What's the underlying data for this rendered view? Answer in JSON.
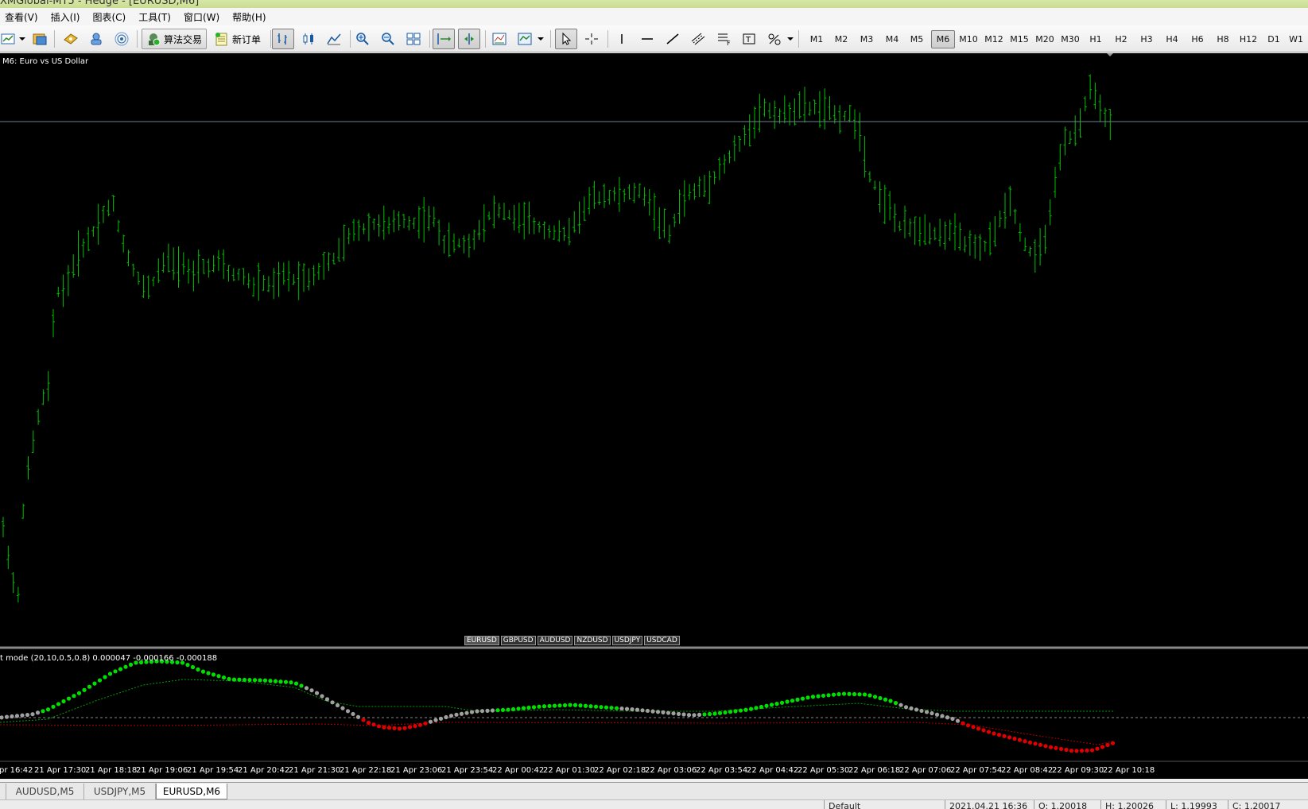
{
  "window": {
    "title": "XMGlobal-MT5 - Hedge - [EURUSD,M6]"
  },
  "menu": [
    "查看(V)",
    "插入(I)",
    "图表(C)",
    "工具(T)",
    "窗口(W)",
    "帮助(H)"
  ],
  "toolbar": {
    "algo_trading_label": "算法交易",
    "new_order_label": "新订单",
    "timeframes": [
      "M1",
      "M2",
      "M3",
      "M4",
      "M5",
      "M6",
      "M10",
      "M12",
      "M15",
      "M20",
      "M30",
      "H1",
      "H2",
      "H3",
      "H4",
      "H6",
      "H8",
      "H12",
      "D1",
      "W1"
    ],
    "active_timeframe": "M6"
  },
  "chart": {
    "label": "M6:  Euro vs US Dollar",
    "indicator_label": "t mode (20,10,0.5,0.8) 0.000047 -0.000166 -0.000188",
    "symbol_tabs": [
      "EURUSD",
      "GBPUSD",
      "AUDUSD",
      "NZDUSD",
      "USDJPY",
      "USDCAD"
    ],
    "active_symbol": "EURUSD",
    "time_labels": [
      "pr 16:42",
      "21 Apr 17:30",
      "21 Apr 18:18",
      "21 Apr 19:06",
      "21 Apr 19:54",
      "21 Apr 20:42",
      "21 Apr 21:30",
      "21 Apr 22:18",
      "21 Apr 23:06",
      "21 Apr 23:54",
      "22 Apr 00:42",
      "22 Apr 01:30",
      "22 Apr 02:18",
      "22 Apr 03:06",
      "22 Apr 03:54",
      "22 Apr 04:42",
      "22 Apr 05:30",
      "22 Apr 06:18",
      "22 Apr 07:06",
      "22 Apr 07:54",
      "22 Apr 08:42",
      "22 Apr 09:30",
      "22 Apr 10:18"
    ],
    "colors": {
      "bars": "#00c000",
      "bg": "#000000",
      "ind_up": "#00e000",
      "ind_neutral": "#a0a0a0",
      "ind_down": "#e00000",
      "price_line": "#708090"
    }
  },
  "chart_tabs": [
    "AUDUSD,M5",
    "USDJPY,M5",
    "EURUSD,M6"
  ],
  "active_chart_tab": "EURUSD,M6",
  "status": {
    "profile": "Default",
    "datetime": "2021.04.21 16:36",
    "open": "O: 1.20018",
    "high": "H: 1.20026",
    "low": "L: 1.19993",
    "close": "C: 1.20017"
  }
}
